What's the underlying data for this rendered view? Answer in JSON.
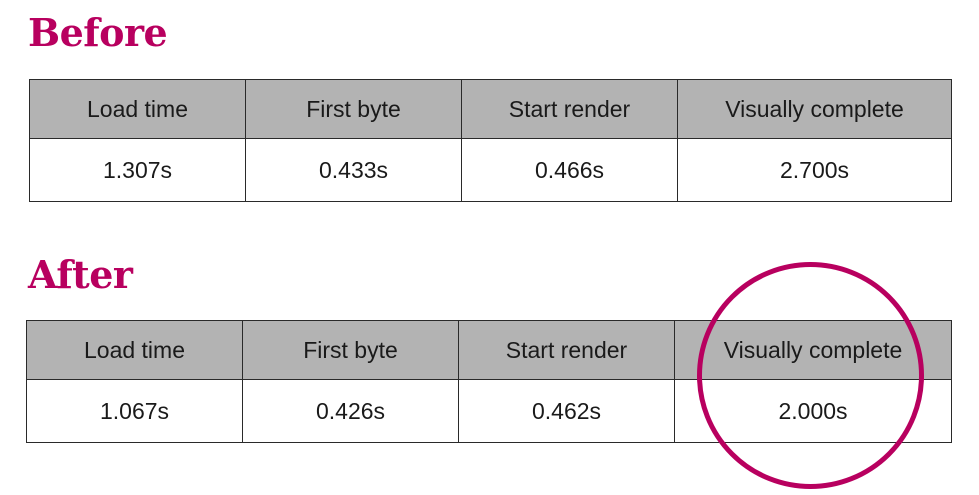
{
  "colors": {
    "accent": "#b8005f",
    "header_fill": "#b3b3b3"
  },
  "before": {
    "title": "Before",
    "headers": [
      "Load time",
      "First byte",
      "Start render",
      "Visually complete"
    ],
    "values": [
      "1.307s",
      "0.433s",
      "0.466s",
      "2.700s"
    ]
  },
  "after": {
    "title": "After",
    "headers": [
      "Load time",
      "First byte",
      "Start render",
      "Visually complete"
    ],
    "values": [
      "1.067s",
      "0.426s",
      "0.462s",
      "2.000s"
    ]
  },
  "annotation": {
    "shape": "circle",
    "highlighted_metric": "Visually complete"
  }
}
